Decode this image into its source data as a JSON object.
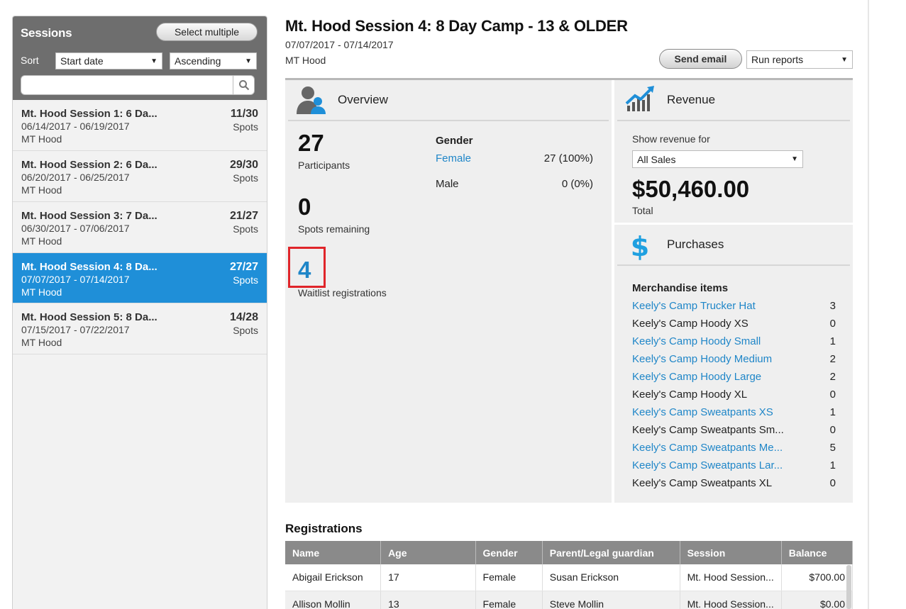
{
  "sidebar": {
    "title": "Sessions",
    "select_multiple": "Select multiple",
    "sort_label": "Sort",
    "sort_by": "Start date",
    "sort_order": "Ascending",
    "search_placeholder": "",
    "sessions": [
      {
        "name": "Mt. Hood Session 1: 6 Da...",
        "dates": "06/14/2017 - 06/19/2017",
        "location": "MT Hood",
        "count": "11/30",
        "spots": "Spots"
      },
      {
        "name": "Mt. Hood Session 2: 6 Da...",
        "dates": "06/20/2017 - 06/25/2017",
        "location": "MT Hood",
        "count": "29/30",
        "spots": "Spots"
      },
      {
        "name": "Mt. Hood Session 3: 7 Da...",
        "dates": "06/30/2017 - 07/06/2017",
        "location": "MT Hood",
        "count": "21/27",
        "spots": "Spots"
      },
      {
        "name": "Mt. Hood Session 4: 8 Da...",
        "dates": "07/07/2017 - 07/14/2017",
        "location": "MT Hood",
        "count": "27/27",
        "spots": "Spots"
      },
      {
        "name": "Mt. Hood Session 5: 8 Da...",
        "dates": "07/15/2017 - 07/22/2017",
        "location": "MT Hood",
        "count": "14/28",
        "spots": "Spots"
      }
    ]
  },
  "header": {
    "title": "Mt. Hood Session 4: 8 Day Camp - 13 & OLDER",
    "dates": "07/07/2017 - 07/14/2017",
    "location": "MT Hood",
    "send_email": "Send email",
    "run_reports": "Run reports"
  },
  "overview": {
    "title": "Overview",
    "participants": "27",
    "participants_label": "Participants",
    "spots_remaining": "0",
    "spots_remaining_label": "Spots remaining",
    "waitlist": "4",
    "waitlist_label": "Waitlist registrations",
    "gender_title": "Gender",
    "female_label": "Female",
    "female_value": "27 (100%)",
    "male_label": "Male",
    "male_value": "0 (0%)"
  },
  "revenue": {
    "title": "Revenue",
    "show_for_label": "Show revenue for",
    "filter": "All Sales",
    "total": "$50,460.00",
    "total_label": "Total"
  },
  "purchases": {
    "title": "Purchases",
    "merch_title": "Merchandise items",
    "items": [
      {
        "name": "Keely's Camp Trucker Hat",
        "qty": "3",
        "link": true
      },
      {
        "name": "Keely's Camp Hoody XS",
        "qty": "0",
        "link": false
      },
      {
        "name": "Keely's Camp Hoody Small",
        "qty": "1",
        "link": true
      },
      {
        "name": "Keely's Camp Hoody Medium",
        "qty": "2",
        "link": true
      },
      {
        "name": "Keely's Camp Hoody Large",
        "qty": "2",
        "link": true
      },
      {
        "name": "Keely's Camp Hoody XL",
        "qty": "0",
        "link": false
      },
      {
        "name": "Keely's Camp Sweatpants XS",
        "qty": "1",
        "link": true
      },
      {
        "name": "Keely's Camp Sweatpants Sm...",
        "qty": "0",
        "link": false
      },
      {
        "name": "Keely's Camp Sweatpants Me...",
        "qty": "5",
        "link": true
      },
      {
        "name": "Keely's Camp Sweatpants Lar...",
        "qty": "1",
        "link": true
      },
      {
        "name": "Keely's Camp Sweatpants XL",
        "qty": "0",
        "link": false
      }
    ]
  },
  "registrations": {
    "title": "Registrations",
    "columns": [
      "Name",
      "Age",
      "Gender",
      "Parent/Legal guardian",
      "Session",
      "Balance"
    ],
    "rows": [
      {
        "name": "Abigail Erickson",
        "age": "17",
        "gender": "Female",
        "guardian": "Susan Erickson",
        "session": "Mt. Hood Session...",
        "balance": "$700.00"
      },
      {
        "name": "Allison Mollin",
        "age": "13",
        "gender": "Female",
        "guardian": "Steve Mollin",
        "session": "Mt. Hood Session...",
        "balance": "$0.00"
      }
    ]
  },
  "colors": {
    "accent": "#1f8fd8",
    "link": "#1f86c8",
    "highlight": "#e0252a",
    "header_gray": "#6e6e6e"
  }
}
